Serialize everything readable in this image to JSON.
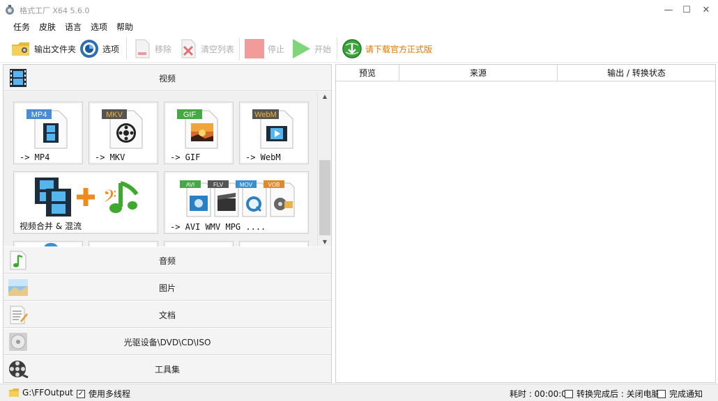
{
  "window": {
    "title": "格式工厂 X64 5.6.0",
    "minimize": "—",
    "maximize": "☐",
    "close": "✕"
  },
  "menu": [
    "任务",
    "皮肤",
    "语言",
    "选项",
    "帮助"
  ],
  "toolbar": {
    "output_folder": "输出文件夹",
    "options": "选项",
    "remove": "移除",
    "clear_list": "清空列表",
    "stop": "停止",
    "start": "开始",
    "download": "请下载官方正式版"
  },
  "colors": {
    "accent_orange": "#e07800",
    "disabled": "#aeaeae",
    "stop_red": "#f08c8c",
    "start_green": "#74d86f"
  },
  "left": {
    "video_header": "视频",
    "tiles": [
      {
        "badge": "MP4",
        "label": "-> MP4",
        "badge_color": "#4a8bd6",
        "icon": "film-icon"
      },
      {
        "badge": "MKV",
        "label": "-> MKV",
        "badge_color": "#555555",
        "icon": "reel-icon"
      },
      {
        "badge": "GIF",
        "label": "-> GIF",
        "badge_color": "#46a845",
        "icon": "sunset-icon"
      },
      {
        "badge": "WebM",
        "label": "-> WebM",
        "badge_color": "#555555",
        "icon": "film-play-icon"
      },
      {
        "label": "视频合并 & 混流",
        "icon": "merge-icon"
      },
      {
        "label": "-> AVI WMV MPG ....",
        "badges": [
          "AVI",
          "FLV",
          "MOV",
          "VOB"
        ],
        "icon": "multi-format-icon"
      }
    ],
    "categories": [
      "音频",
      "图片",
      "文档",
      "光驱设备\\DVD\\CD\\ISO",
      "工具集"
    ]
  },
  "right": {
    "columns": [
      "预览",
      "来源",
      "输出 / 转换状态"
    ]
  },
  "status": {
    "path": "G:\\FFOutput",
    "multithread": "使用多线程",
    "multithread_checked": true,
    "elapsed": "耗时 : 00:00:00",
    "after_done": "转换完成后 : 关闭电脑",
    "after_done_checked": false,
    "notify": "完成通知",
    "notify_checked": false
  }
}
